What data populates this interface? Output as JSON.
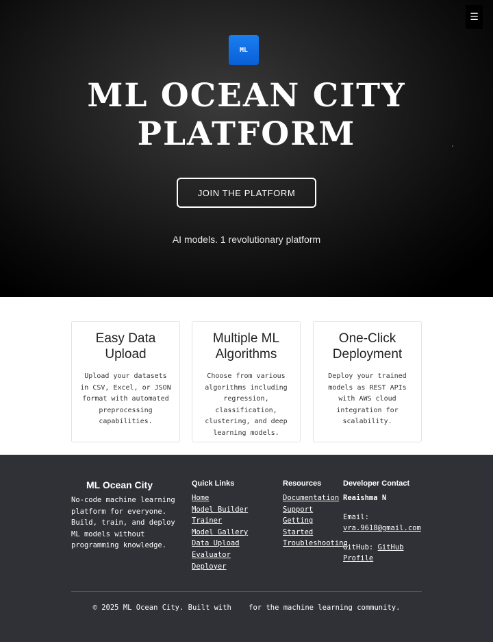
{
  "menu": {
    "icon": "☰"
  },
  "hero": {
    "logo_text": "ML",
    "title_line1": "ML OCEAN CITY",
    "title_line2": "PLATFORM",
    "cta_label": "JOIN THE PLATFORM",
    "tagline": "AI models. 1 revolutionary platform"
  },
  "features": [
    {
      "title": "Easy Data Upload",
      "description": "Upload your datasets in CSV, Excel, or JSON format with automated preprocessing capabilities."
    },
    {
      "title": "Multiple ML Algorithms",
      "description": "Choose from various algorithms including regression, classification, clustering, and deep learning models."
    },
    {
      "title": "One-Click Deployment",
      "description": "Deploy your trained models as REST APIs with AWS cloud integration for scalability."
    }
  ],
  "footer": {
    "brand_title": "ML Ocean City",
    "brand_description": "No-code machine learning platform for everyone. Build, train, and deploy ML models without programming knowledge.",
    "quick_links": {
      "heading": "Quick Links",
      "items": [
        "Home",
        "Model Builder",
        "Trainer",
        "Model Gallery",
        "Data Upload",
        "Evaluator",
        "Deployer"
      ]
    },
    "resources": {
      "heading": "Resources",
      "items": [
        "Documentation",
        "Support",
        "Getting Started",
        "Troubleshooting"
      ]
    },
    "developer": {
      "heading": "Developer Contact",
      "name": "Reaishma N",
      "email_label": "Email:",
      "email": "vra.9618@gmail.com",
      "github_label": "GitHub:",
      "github_link": "GitHub Profile"
    },
    "copyright": "© 2025 ML Ocean City. Built with    for the machine learning community."
  },
  "colors": {
    "accent": "#0a6fe6",
    "footer_bg": "#2f3136",
    "hero_bg": "#1f1f1f"
  }
}
